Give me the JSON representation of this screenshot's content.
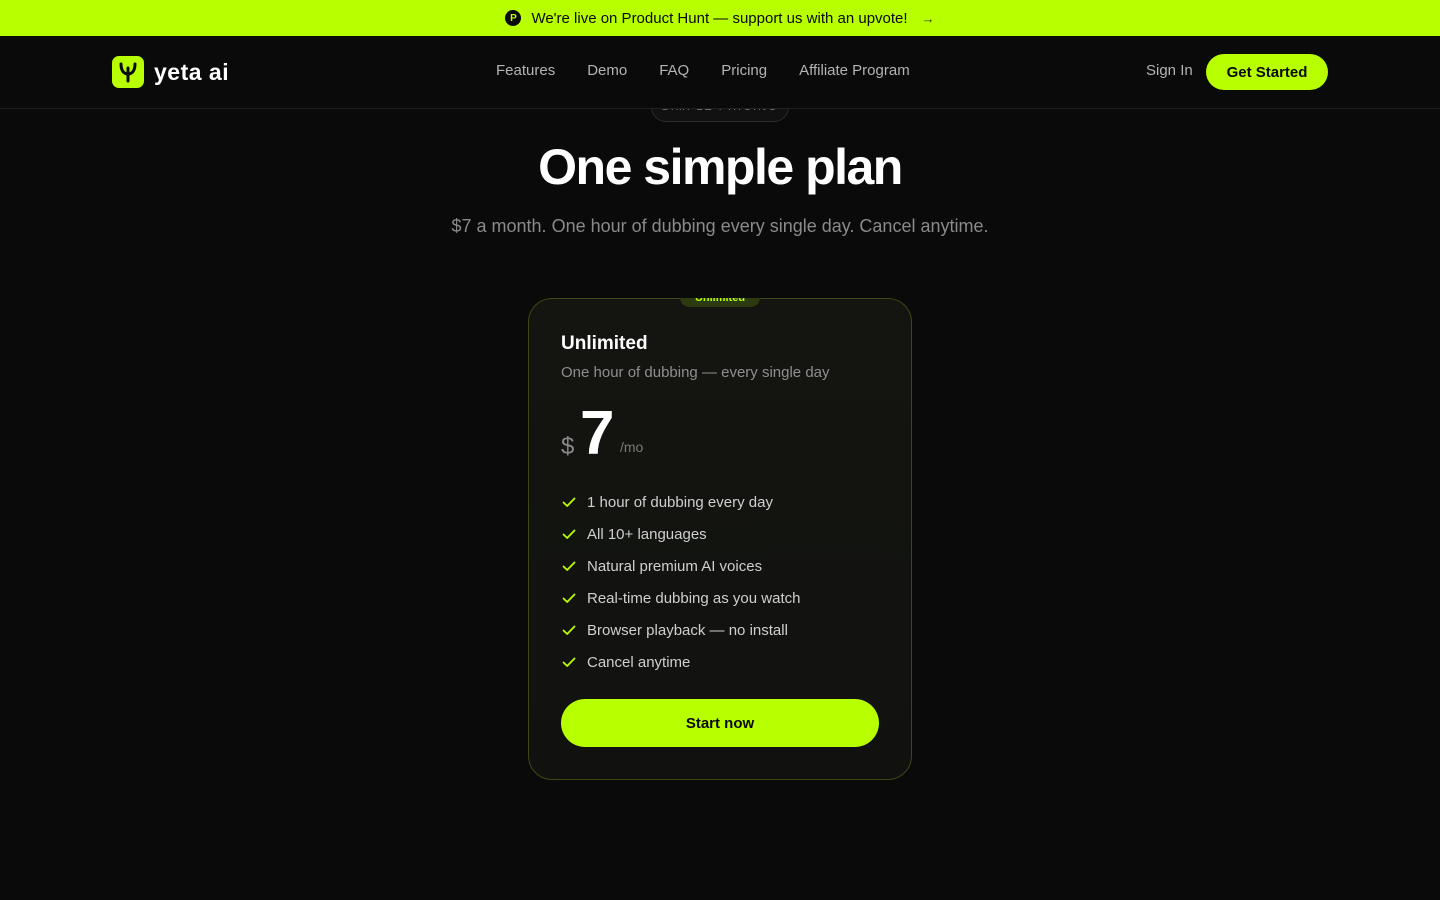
{
  "announcement": {
    "icon": "product-hunt-icon",
    "icon_letter": "P",
    "text": "We're live on Product Hunt — support us with an upvote!",
    "arrow": "→"
  },
  "header": {
    "logo_text": "yeta ai",
    "nav": [
      {
        "label": "Features"
      },
      {
        "label": "Demo"
      },
      {
        "label": "FAQ"
      },
      {
        "label": "Pricing"
      },
      {
        "label": "Affiliate Program"
      }
    ],
    "sign_in": "Sign In",
    "get_started": "Get Started"
  },
  "hero": {
    "eyebrow": "SIMPLE PRICING",
    "title": "One simple plan",
    "subtitle": "$7 a month. One hour of dubbing every single day. Cancel anytime."
  },
  "plan": {
    "badge": "Unlimited",
    "name": "Unlimited",
    "description": "One hour of dubbing — every single day",
    "currency": "$",
    "amount": "7",
    "period": "/mo",
    "features": [
      "1 hour of dubbing every day",
      "All 10+ languages",
      "Natural premium AI voices",
      "Real-time dubbing as you watch",
      "Browser playback — no install",
      "Cancel anytime"
    ],
    "cta": "Start now"
  },
  "colors": {
    "accent": "#b8ff00",
    "background": "#0a0a0a",
    "muted_text": "#8a8a8a"
  }
}
